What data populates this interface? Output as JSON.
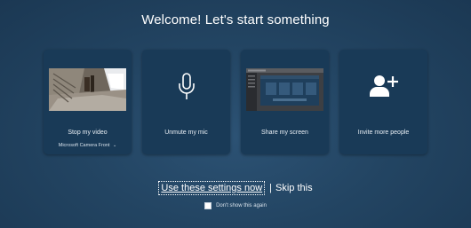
{
  "header": {
    "title": "Welcome! Let's start something"
  },
  "cards": [
    {
      "label": "Stop my video",
      "sub": "Microsoft Camera Front",
      "sub_caret": "⌄",
      "icon": "camera-preview"
    },
    {
      "label": "Unmute my mic",
      "icon": "microphone-icon"
    },
    {
      "label": "Share my screen",
      "icon": "screen-preview"
    },
    {
      "label": "Invite more people",
      "icon": "add-person-icon"
    }
  ],
  "actions": {
    "primary": "Use these settings now",
    "separator": "|",
    "secondary": "Skip this"
  },
  "checkbox": {
    "label": "Don't show this again",
    "checked": false
  },
  "colors": {
    "background": "#234563",
    "card": "#193a57",
    "text": "#ffffff"
  }
}
